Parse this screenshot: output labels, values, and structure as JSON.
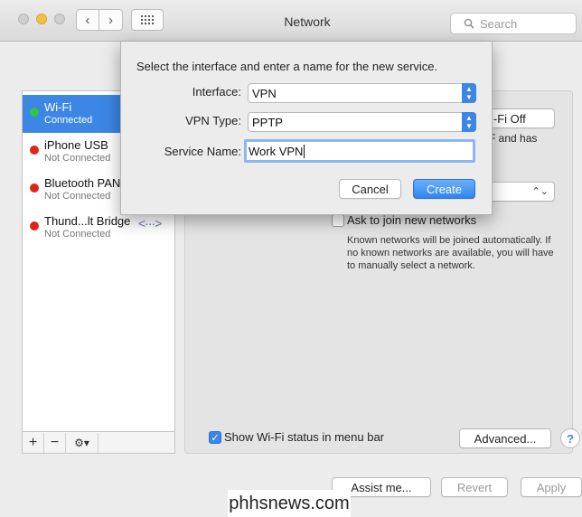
{
  "window": {
    "title": "Network"
  },
  "search": {
    "placeholder": "Search"
  },
  "sidebar": {
    "services": [
      {
        "name": "Wi-Fi",
        "status": "Connected",
        "status_color": "#2fc540"
      },
      {
        "name": "iPhone USB",
        "status": "Not Connected",
        "status_color": "#e0241c"
      },
      {
        "name": "Bluetooth PAN",
        "status": "Not Connected",
        "status_color": "#e0241c"
      },
      {
        "name": "Thund...lt Bridge",
        "status": "Not Connected",
        "status_color": "#e0241c"
      }
    ],
    "toolbar": {
      "add": "+",
      "remove": "−",
      "gear": "⚙▾"
    }
  },
  "main": {
    "wifi_off_label": "i-Fi Off",
    "partial_line1": "F and has",
    "partial_line2": "",
    "ask_join_label": "Ask to join new networks",
    "ask_join_checked": false,
    "known_networks_text": "Known networks will be joined automatically. If no known networks are available, you will have to manually select a network.",
    "show_status_label": "Show Wi-Fi status in menu bar",
    "show_status_checked": true,
    "advanced_label": "Advanced...",
    "help_label": "?",
    "assist_label": "Assist me...",
    "revert_label": "Revert",
    "apply_label": "Apply"
  },
  "dialog": {
    "prompt": "Select the interface and enter a name for the new service.",
    "interface_label": "Interface:",
    "interface_value": "VPN",
    "vpn_type_label": "VPN Type:",
    "vpn_type_value": "PPTP",
    "service_name_label": "Service Name:",
    "service_name_value": "Work VPN",
    "cancel_label": "Cancel",
    "create_label": "Create"
  },
  "watermark": {
    "text": "phhsnews.com"
  },
  "colors": {
    "accent": "#3c86e6",
    "connected": "#2fc540",
    "disconnected": "#e0241c"
  }
}
